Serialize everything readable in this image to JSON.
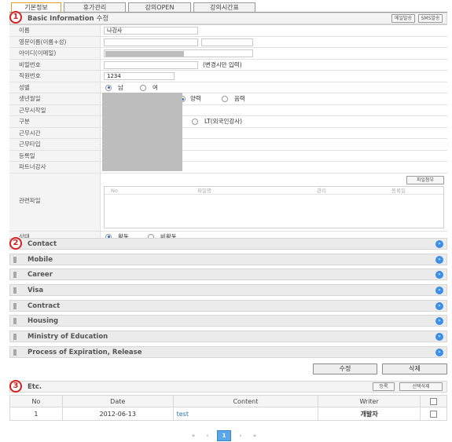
{
  "tabs": [
    "기본정보",
    "휴가관리",
    "강의OPEN",
    "강의시간표"
  ],
  "basic": {
    "title": "Basic Information",
    "title_suffix": "수정",
    "btn1": "메일발송",
    "btn2": "SMS발송",
    "fields": {
      "name_label": "이름",
      "name_value": "나강사",
      "eng_label": "영문이름(이름+성)",
      "id_label": "아이디(이메일)",
      "pw_label": "비밀번호",
      "pw_note": "(변경시만 입력)",
      "emp_label": "직원번호",
      "emp_value": "1234",
      "gender_label": "성별",
      "gender_male": "남",
      "gender_female": "여",
      "birth_label": "생년월일",
      "cal_solar": "양력",
      "cal_lunar": "음력",
      "start_label": "근무시작일",
      "type_label": "구분",
      "type_option": "LT(외국인강사)",
      "hours_label": "근무시간",
      "worktype_label": "근무타입",
      "regdate_label": "등록일",
      "partner_label": "파트너강사",
      "file_label": "관련파일",
      "file_btn": "파일첨부",
      "file_cols": [
        "No",
        "파일명",
        "관리",
        "등록일"
      ],
      "status_label": "상태",
      "status_active": "활동",
      "status_inactive": "비활동"
    }
  },
  "sections": [
    "Contact",
    "Mobile",
    "Career",
    "Visa",
    "Contract",
    "Housing",
    "Ministry of Education",
    "Process of Expiration, Release"
  ],
  "actions": {
    "edit": "수정",
    "delete": "삭제"
  },
  "etc": {
    "title": "Etc.",
    "btn_register": "등록",
    "btn_delete_selected": "선택삭제",
    "columns": [
      "No",
      "Date",
      "Content",
      "Writer"
    ],
    "rows": [
      {
        "no": "1",
        "date": "2012-06-13",
        "content": "test",
        "writer": "개발자"
      }
    ]
  },
  "pager": {
    "first": "«",
    "prev": "‹",
    "current": "1",
    "next": "›",
    "last": "»"
  },
  "markers": [
    "1",
    "2",
    "3"
  ],
  "colors": {
    "marker": "#d42020",
    "expand": "#3a8ee6",
    "active_page": "#5aa6e6",
    "active_tab_border": "#e0a020"
  }
}
